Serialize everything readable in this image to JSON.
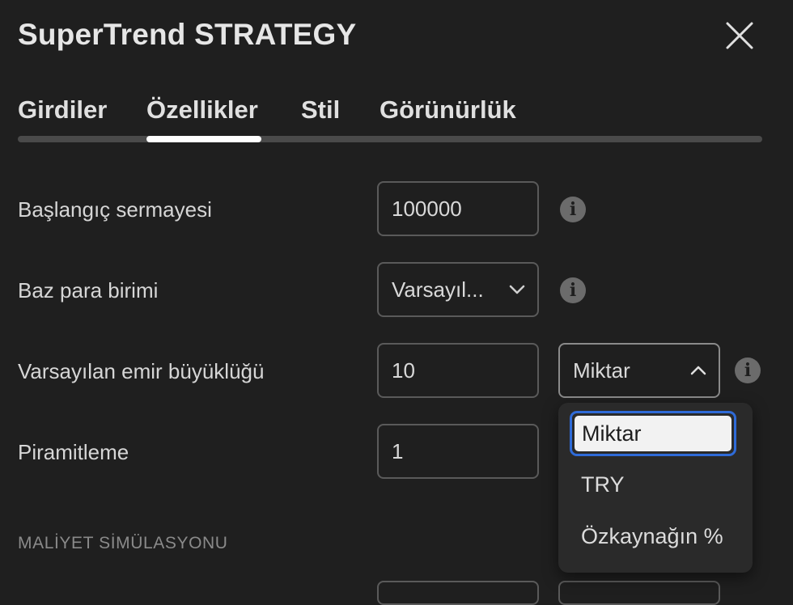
{
  "dialog": {
    "title": "SuperTrend STRATEGY"
  },
  "tabs": [
    {
      "label": "Girdiler"
    },
    {
      "label": "Özellikler",
      "active": true
    },
    {
      "label": "Stil"
    },
    {
      "label": "Görünürlük"
    }
  ],
  "fields": {
    "initial_capital": {
      "label": "Başlangıç sermayesi",
      "value": "100000"
    },
    "base_currency": {
      "label": "Baz para birimi",
      "value": "Varsayıl..."
    },
    "order_size": {
      "label": "Varsayılan emir büyüklüğü",
      "value": "10",
      "unit": "Miktar"
    },
    "pyramiding": {
      "label": "Piramitleme",
      "value": "1"
    }
  },
  "section": {
    "cost_simulation": "MALİYET SİMÜLASYONU"
  },
  "dropdown": {
    "options": [
      "Miktar",
      "TRY",
      "Özkaynağın %"
    ],
    "selected": "Miktar"
  },
  "colors": {
    "background": "#1f1f1f",
    "accent": "#2f6bd8",
    "tab_indicator": "#ffffff"
  },
  "icons": {
    "close": "close-icon",
    "info": "info-icon",
    "chevron_down": "chevron-down-icon",
    "chevron_up": "chevron-up-icon"
  }
}
